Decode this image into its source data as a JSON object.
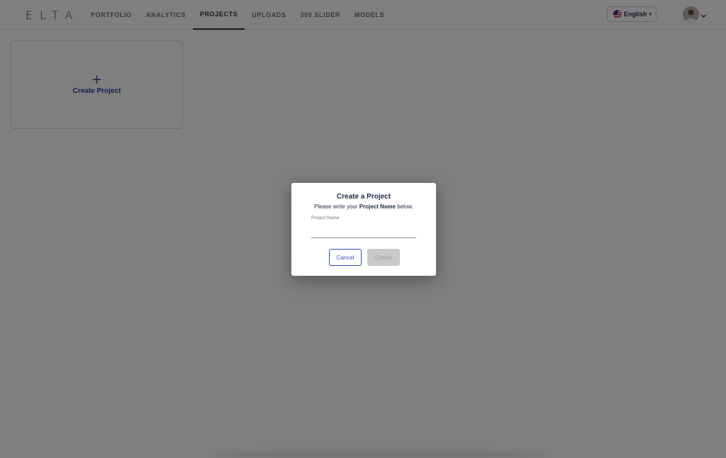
{
  "header": {
    "logo_text": "ELTA",
    "nav": [
      {
        "label": "PORTFOLIO",
        "active": false
      },
      {
        "label": "ANALYTICS",
        "active": false
      },
      {
        "label": "PROJECTS",
        "active": true
      },
      {
        "label": "UPLOADS",
        "active": false
      },
      {
        "label": "360 SLIDER",
        "active": false
      },
      {
        "label": "MODELS",
        "active": false
      }
    ],
    "language": {
      "label": "English",
      "flag_icon": "us-flag-icon"
    },
    "user_menu": {
      "avatar_icon": "user-avatar",
      "chevron_icon": "chevron-down-icon"
    }
  },
  "projects": {
    "create_card": {
      "icon": "plus-icon",
      "label": "Create Project"
    }
  },
  "modal": {
    "title": "Create a Project",
    "subtitle_prefix": "Please write your ",
    "subtitle_bold": "Project Name",
    "subtitle_suffix": " below.",
    "field": {
      "label": "Project Name",
      "value": "",
      "placeholder": ""
    },
    "cancel_label": "Cancel",
    "create_label": "Create",
    "create_disabled": true
  },
  "colors": {
    "accent": "#2f51c0",
    "nav_active": "#2a3147",
    "overlay": "rgba(0,0,0,0.5)",
    "disabled_button": "#c9c9c9"
  }
}
